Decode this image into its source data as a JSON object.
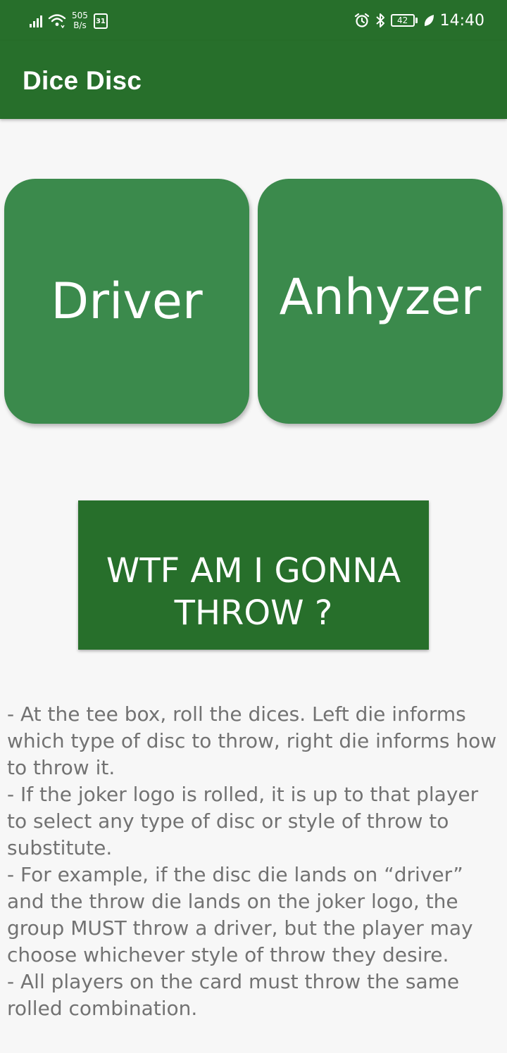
{
  "status_bar": {
    "net_speed_value": "505",
    "net_speed_unit": "B/s",
    "calendar_day": "31",
    "battery_level": "42",
    "time": "14:40"
  },
  "app_bar": {
    "title": "Dice Disc"
  },
  "dice": {
    "disc_die": "Driver",
    "throw_die": "Anhyzer"
  },
  "roll_button": {
    "label": "WTF AM I GONNA\nTHROW ?"
  },
  "instructions": [
    "- At the tee box, roll the dices. Left die informs which type of disc to throw, right die informs how to throw it.",
    " - If the joker logo is rolled, it is up to that player to select any type of disc or style of throw to substitute.",
    " - For example, if the disc die lands on “driver” and the throw die lands on the joker logo, the group MUST throw a driver, but the player may choose whichever style of throw they desire.",
    " - All players on the card must throw the same rolled combination."
  ],
  "colors": {
    "primary_dark": "#276f2b",
    "die_green": "#3b8a4c",
    "body_text": "#727272",
    "background": "#f7f7f7"
  },
  "icons": [
    "signal-icon",
    "wifi-icon",
    "calendar-icon",
    "alarm-icon",
    "bluetooth-icon",
    "battery-icon",
    "leaf-icon"
  ]
}
